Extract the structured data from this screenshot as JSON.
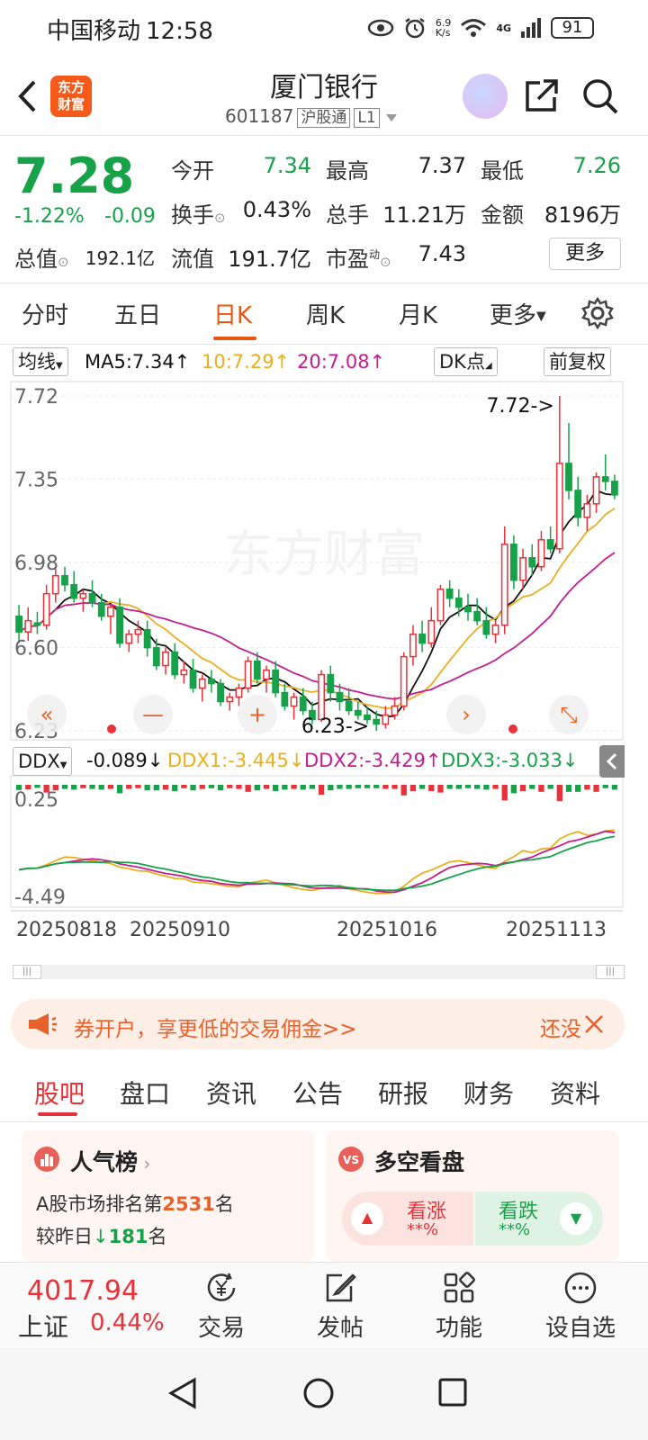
{
  "status": {
    "carrier": "中国移动",
    "time": "12:58",
    "net_speed": "6.9\nK/s",
    "net_type": "4G",
    "battery": "91"
  },
  "header": {
    "logo_text": "东方\n财富",
    "stock_name": "厦门银行",
    "stock_code": "601187",
    "market_tag": "沪股通",
    "level_tag": "L1"
  },
  "quote": {
    "price": "7.28",
    "change_pct": "-1.22%",
    "change_amt": "-0.09",
    "fields": [
      {
        "label": "今开",
        "value": "7.34"
      },
      {
        "label": "最高",
        "value": "7.37"
      },
      {
        "label": "最低",
        "value": "7.26"
      },
      {
        "label": "换手",
        "value": "0.43%"
      },
      {
        "label": "总手",
        "value": "11.21万"
      },
      {
        "label": "金额",
        "value": "8196万"
      },
      {
        "label": "总值",
        "value": "192.1亿"
      },
      {
        "label": "流值",
        "value": "191.7亿"
      },
      {
        "label": "市盈",
        "label_sup": "动",
        "value": "7.43"
      }
    ],
    "more_label": "更多"
  },
  "chart_tabs": [
    "分时",
    "五日",
    "日K",
    "周K",
    "月K",
    "更多"
  ],
  "active_chart_tab": "日K",
  "indicators": {
    "ma_selector": "均线",
    "ma5": "MA5:7.34↑",
    "ma10": "10:7.29↑",
    "ma20": "20:7.08↑",
    "dk_label": "DK点",
    "adjust_label": "前复权",
    "ddx_selector": "DDX",
    "ddx": "-0.089↓",
    "ddx1": "DDX1:-3.445↓",
    "ddx2": "DDX2:-3.429↑",
    "ddx3": "DDX3:-3.033↓"
  },
  "colors": {
    "up": "#e8323a",
    "down": "#17a24a",
    "ma5": "#111111",
    "ma10": "#e8b020",
    "ma20": "#c0208e",
    "accent": "#e8560f"
  },
  "chart_data": {
    "type": "candlestick",
    "price_axis_ticks": [
      "7.72",
      "7.35",
      "6.98",
      "6.60",
      "6.23"
    ],
    "ylim": [
      6.23,
      7.72
    ],
    "date_labels": [
      "20250818",
      "20250910",
      "20251016",
      "20251113"
    ],
    "annotations": {
      "high": "7.72->",
      "low": "6.23->"
    },
    "ohlc": [
      [
        6.74,
        6.79,
        6.62,
        6.67
      ],
      [
        6.67,
        6.78,
        6.63,
        6.72
      ],
      [
        6.71,
        6.76,
        6.66,
        6.7
      ],
      [
        6.7,
        6.88,
        6.68,
        6.84
      ],
      [
        6.84,
        6.95,
        6.8,
        6.92
      ],
      [
        6.92,
        6.96,
        6.85,
        6.88
      ],
      [
        6.88,
        6.94,
        6.8,
        6.82
      ],
      [
        6.82,
        6.86,
        6.76,
        6.84
      ],
      [
        6.84,
        6.9,
        6.78,
        6.8
      ],
      [
        6.8,
        6.84,
        6.72,
        6.74
      ],
      [
        6.74,
        6.79,
        6.66,
        6.78
      ],
      [
        6.78,
        6.82,
        6.6,
        6.62
      ],
      [
        6.62,
        6.68,
        6.58,
        6.66
      ],
      [
        6.66,
        6.72,
        6.62,
        6.68
      ],
      [
        6.68,
        6.72,
        6.56,
        6.6
      ],
      [
        6.6,
        6.64,
        6.5,
        6.52
      ],
      [
        6.52,
        6.6,
        6.48,
        6.58
      ],
      [
        6.58,
        6.62,
        6.46,
        6.48
      ],
      [
        6.48,
        6.54,
        6.44,
        6.5
      ],
      [
        6.5,
        6.55,
        6.4,
        6.42
      ],
      [
        6.42,
        6.48,
        6.36,
        6.46
      ],
      [
        6.46,
        6.5,
        6.4,
        6.44
      ],
      [
        6.44,
        6.46,
        6.34,
        6.36
      ],
      [
        6.36,
        6.4,
        6.32,
        6.38
      ],
      [
        6.38,
        6.44,
        6.34,
        6.42
      ],
      [
        6.42,
        6.56,
        6.4,
        6.54
      ],
      [
        6.54,
        6.58,
        6.44,
        6.46
      ],
      [
        6.46,
        6.52,
        6.4,
        6.5
      ],
      [
        6.5,
        6.54,
        6.38,
        6.4
      ],
      [
        6.4,
        6.44,
        6.32,
        6.34
      ],
      [
        6.34,
        6.4,
        6.28,
        6.38
      ],
      [
        6.38,
        6.42,
        6.3,
        6.32
      ],
      [
        6.32,
        6.36,
        6.26,
        6.28
      ],
      [
        6.28,
        6.5,
        6.27,
        6.48
      ],
      [
        6.48,
        6.52,
        6.36,
        6.4
      ],
      [
        6.4,
        6.44,
        6.32,
        6.36
      ],
      [
        6.36,
        6.42,
        6.3,
        6.32
      ],
      [
        6.32,
        6.36,
        6.28,
        6.3
      ],
      [
        6.3,
        6.34,
        6.26,
        6.28
      ],
      [
        6.28,
        6.32,
        6.23,
        6.26
      ],
      [
        6.26,
        6.34,
        6.24,
        6.3
      ],
      [
        6.3,
        6.38,
        6.28,
        6.34
      ],
      [
        6.34,
        6.58,
        6.32,
        6.56
      ],
      [
        6.56,
        6.7,
        6.52,
        6.66
      ],
      [
        6.66,
        6.72,
        6.58,
        6.62
      ],
      [
        6.62,
        6.78,
        6.6,
        6.72
      ],
      [
        6.72,
        6.88,
        6.7,
        6.86
      ],
      [
        6.86,
        6.9,
        6.78,
        6.82
      ],
      [
        6.82,
        6.86,
        6.74,
        6.78
      ],
      [
        6.78,
        6.84,
        6.72,
        6.76
      ],
      [
        6.76,
        6.82,
        6.7,
        6.72
      ],
      [
        6.72,
        6.78,
        6.64,
        6.66
      ],
      [
        6.66,
        6.72,
        6.62,
        6.7
      ],
      [
        6.7,
        7.14,
        6.66,
        7.06
      ],
      [
        7.06,
        7.1,
        6.86,
        6.9
      ],
      [
        6.9,
        7.04,
        6.86,
        7.0
      ],
      [
        7.0,
        7.06,
        6.92,
        6.96
      ],
      [
        6.96,
        7.12,
        6.94,
        7.08
      ],
      [
        7.08,
        7.14,
        7.02,
        7.04
      ],
      [
        7.04,
        7.72,
        7.02,
        7.42
      ],
      [
        7.42,
        7.6,
        7.26,
        7.3
      ],
      [
        7.3,
        7.36,
        7.14,
        7.18
      ],
      [
        7.18,
        7.28,
        7.12,
        7.24
      ],
      [
        7.24,
        7.38,
        7.2,
        7.36
      ],
      [
        7.36,
        7.46,
        7.3,
        7.34
      ],
      [
        7.34,
        7.37,
        7.26,
        7.28
      ]
    ],
    "ddx_panel": {
      "ylabels": [
        "0.25",
        "-4.49"
      ]
    }
  },
  "promo": {
    "text": "券开户，享更低的交易佣金>>",
    "right_text": "还没"
  },
  "bottom_tabs": [
    "股吧",
    "盘口",
    "资讯",
    "公告",
    "研报",
    "财务",
    "资料"
  ],
  "active_bottom_tab": "股吧",
  "cards": {
    "popularity": {
      "title": "人气榜",
      "line1_prefix": "A股市场排名第",
      "rank": "2531",
      "line1_suffix": "名",
      "line2_prefix": "较昨日",
      "delta": "181",
      "line2_suffix": "名"
    },
    "sentiment": {
      "title": "多空看盘",
      "bull_label": "看涨",
      "bull_value": "**%",
      "bear_label": "看跌",
      "bear_value": "**%"
    }
  },
  "bottom_nav": {
    "index_value": "4017.94",
    "index_name": "上证",
    "index_change": "0.44%",
    "items": [
      "交易",
      "发帖",
      "功能",
      "设自选"
    ]
  }
}
